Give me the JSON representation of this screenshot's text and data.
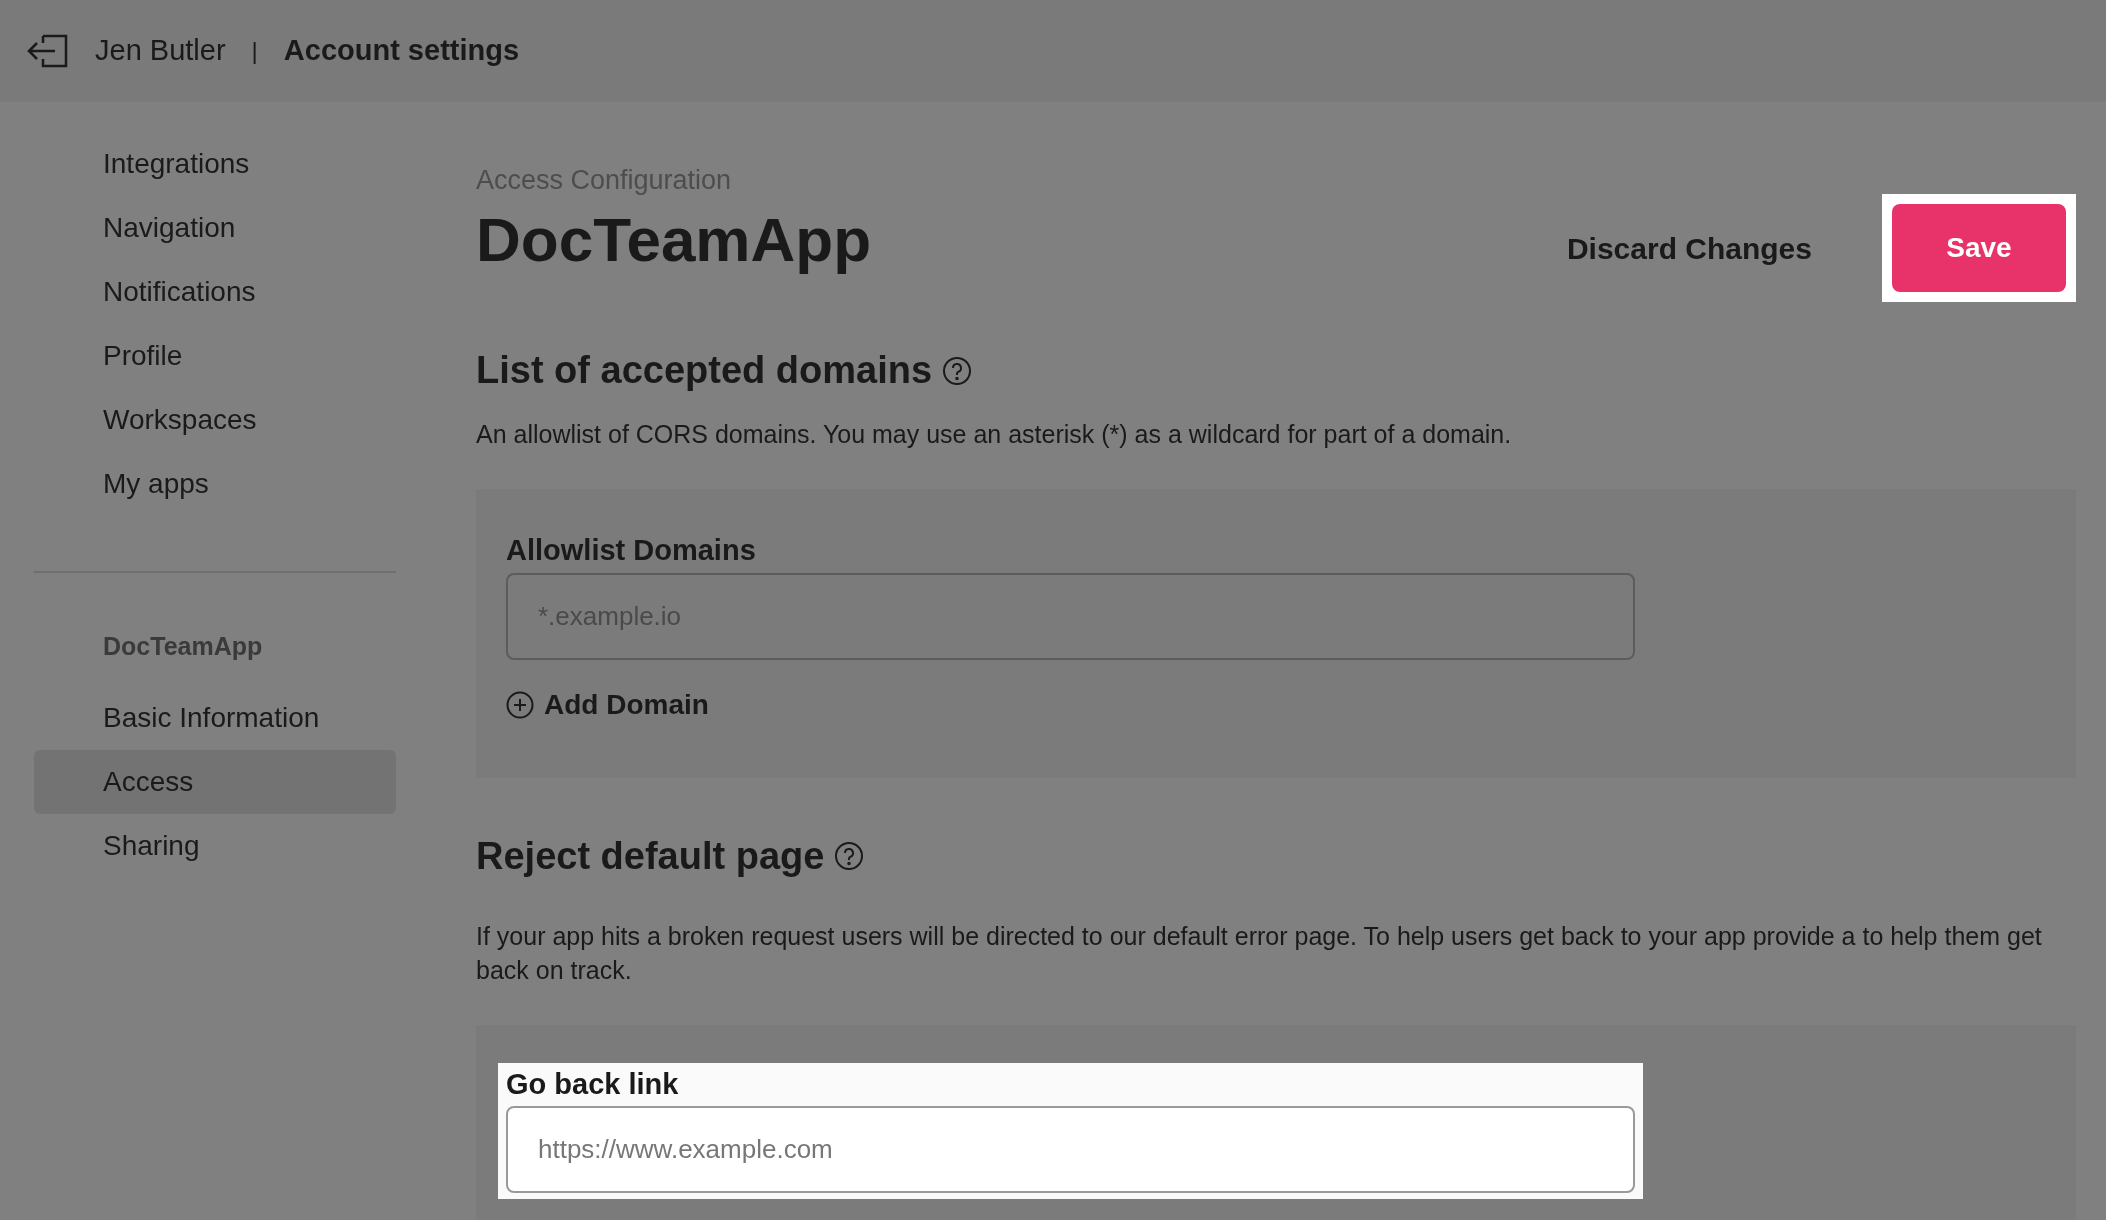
{
  "header": {
    "user": "Jen Butler",
    "separator": "|",
    "title": "Account settings"
  },
  "sidebar": {
    "items": [
      {
        "label": "Integrations",
        "selected": false
      },
      {
        "label": "Navigation",
        "selected": false
      },
      {
        "label": "Notifications",
        "selected": false
      },
      {
        "label": "Profile",
        "selected": false
      },
      {
        "label": "Workspaces",
        "selected": false
      },
      {
        "label": "My apps",
        "selected": false
      }
    ],
    "app_heading": "DocTeamApp",
    "app_items": [
      {
        "label": "Basic Information",
        "selected": false
      },
      {
        "label": "Access",
        "selected": true
      },
      {
        "label": "Sharing",
        "selected": false
      }
    ]
  },
  "main": {
    "breadcrumb": "Access Configuration",
    "title": "DocTeamApp",
    "discard_button": "Discard Changes",
    "save_button": "Save",
    "sections": [
      {
        "heading": "List of accepted domains",
        "description": "An allowlist of CORS domains. You may use an asterisk (*) as a wildcard for part of a domain.",
        "field_label": "Allowlist Domains",
        "placeholder": "*.example.io",
        "highlighted": false,
        "add_button": "Add Domain"
      },
      {
        "heading": "Reject default page",
        "description": "If your app hits a broken request users will be directed to our default error page. To help users get back to your app provide a to help them get back on track.",
        "field_label": "Go back link",
        "placeholder": "https://www.example.com",
        "highlighted": true
      }
    ]
  }
}
